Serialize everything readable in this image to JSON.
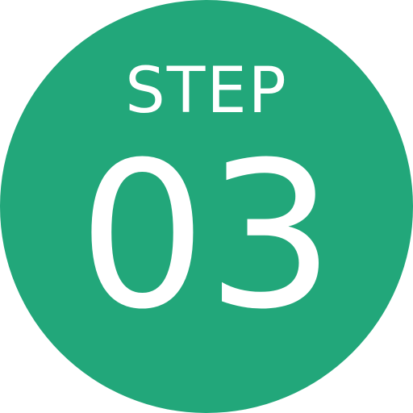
{
  "badge": {
    "label": "STEP",
    "number": "03",
    "background_color": "#22a77a",
    "text_color": "#ffffff"
  }
}
